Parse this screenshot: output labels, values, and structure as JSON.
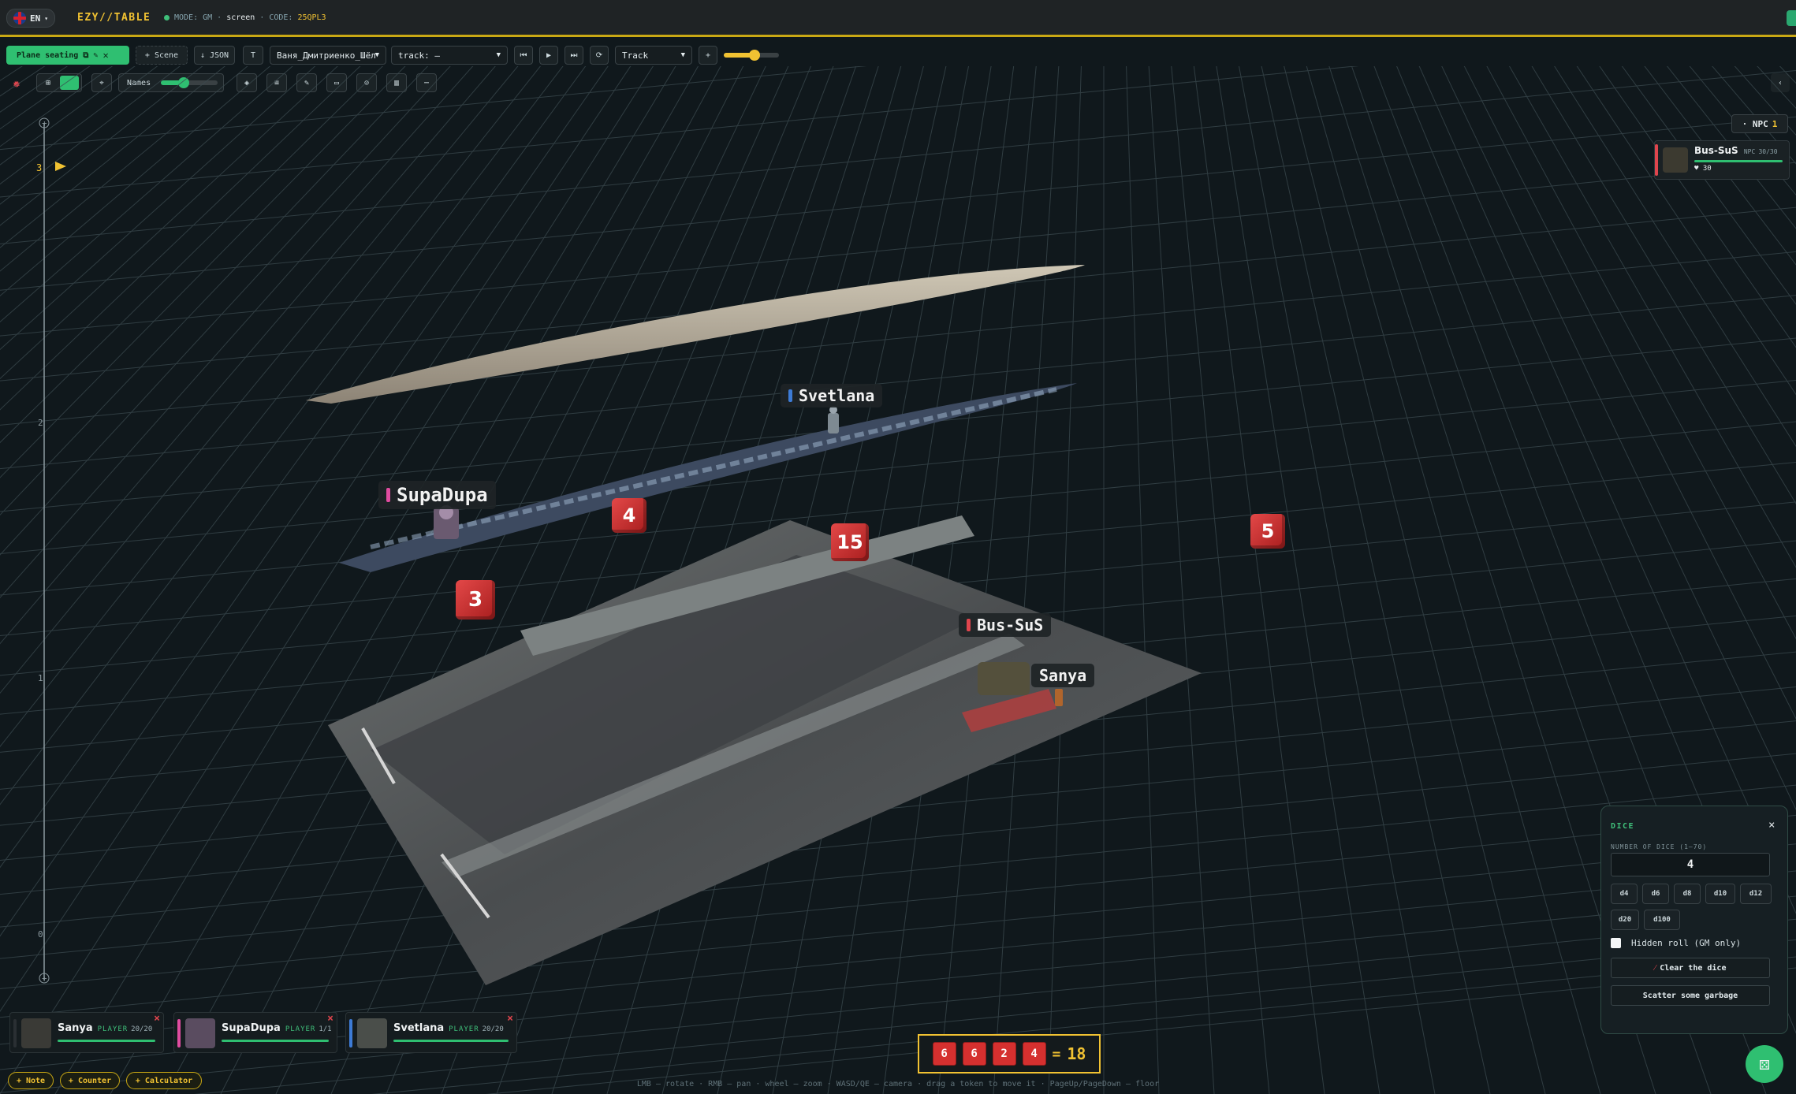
{
  "topbar": {
    "lang": "EN",
    "brand": "EZY//TABLE",
    "mode_label": "MODE:",
    "mode_value": "GM",
    "screen": "screen",
    "code_label": "CODE:",
    "code_value": "25QPL3",
    "separator": "·"
  },
  "toolbar": {
    "scene_name": "Plane seating",
    "add_scene": "+ Scene",
    "json": "↓ JSON",
    "t_button": "T",
    "user_select": "Ваня_Дмитриенко_Шёлк",
    "track_select": "track: —",
    "track_mode": "Track",
    "names_label": "Names",
    "speed_level": 0.55,
    "names_level": 0.4
  },
  "scene": {
    "ruler_marks": [
      "3",
      "2",
      "1",
      "0"
    ],
    "ruler_plus": "+",
    "tokens": [
      {
        "name": "Svetlana",
        "color": "#3d7bd6"
      },
      {
        "name": "SupaDupa",
        "color": "#e04ca0"
      },
      {
        "name": "Bus-SuS",
        "color": "#e0454d"
      },
      {
        "name": "Sanya",
        "color": ""
      }
    ],
    "dice_3d": [
      "4",
      "15",
      "3",
      "5"
    ]
  },
  "npc_panel": {
    "chip_label": "· NPC",
    "count": "1",
    "card_name": "Bus-SuS",
    "card_role": "NPC",
    "card_hp": "30/30",
    "card_heart": "30"
  },
  "dice_panel": {
    "title": "DICE",
    "close": "×",
    "count_label": "NUMBER OF DICE (1–70)",
    "count_value": "4",
    "types": [
      "d4",
      "d6",
      "d8",
      "d10",
      "d12",
      "d20",
      "d100"
    ],
    "hidden_label": "Hidden roll (GM only)",
    "clear_label": "Clear the dice",
    "scatter_label": "Scatter some garbage"
  },
  "party": [
    {
      "name": "Sanya",
      "role": "PLAYER",
      "hp": "20/20",
      "color": "#2a2f33",
      "hp_frac": 1.0
    },
    {
      "name": "SupaDupa",
      "role": "PLAYER",
      "hp": "1/1",
      "color": "#e04ca0",
      "hp_frac": 1.0
    },
    {
      "name": "Svetlana",
      "role": "PLAYER",
      "hp": "20/20",
      "color": "#3d7bd6",
      "hp_frac": 1.0
    }
  ],
  "bottom_buttons": {
    "note": "+ Note",
    "counter": "+ Counter",
    "calculator": "+ Calculator"
  },
  "roll": {
    "dice": [
      "6",
      "6",
      "2",
      "4"
    ],
    "equals": "=",
    "total": "18"
  },
  "hint": "LMB — rotate · RMB — pan · wheel — zoom · WASD/QE — camera · drag a token to move it · PageUp/PageDown — floor"
}
